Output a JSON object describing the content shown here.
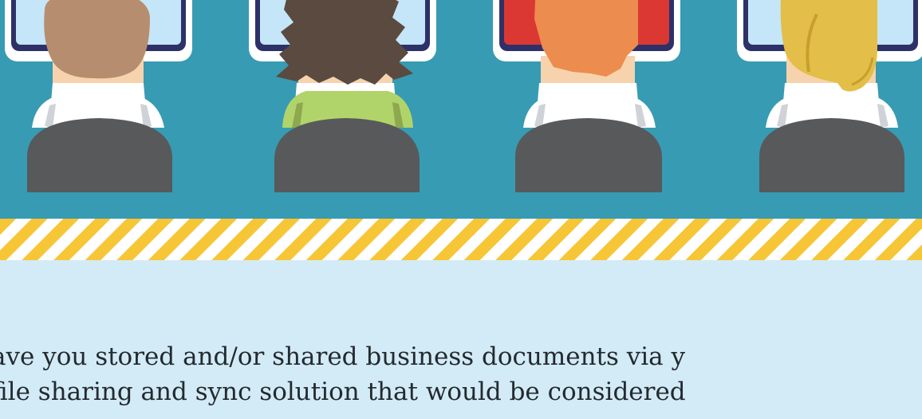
{
  "scene": {
    "colors": {
      "background": "#379bb3",
      "monitor_frame": "#ffffff",
      "monitor_border": "#2e3168",
      "monitor_screen": "#c4e6f8",
      "monitor_screen_red": "#db3834",
      "chair": "#58595b",
      "shirt": "#ffffff",
      "neck": "#f6d3ad",
      "hair_brown": "#b78d6f",
      "hair_dark": "#5a4a40",
      "hair_orange": "#ec8c4e",
      "hair_blonde": "#e3be48",
      "shirt_green": "#b1d46a"
    },
    "people": [
      {
        "icon": "person-brown-hair-icon",
        "hair": "short-brown",
        "screen": "blue"
      },
      {
        "icon": "person-dark-curly-hair-icon",
        "hair": "dark-curly",
        "screen": "blue"
      },
      {
        "icon": "person-orange-hair-icon",
        "hair": "orange",
        "screen": "red"
      },
      {
        "icon": "person-blonde-hair-icon",
        "hair": "blonde",
        "screen": "blue"
      }
    ]
  },
  "divider": {
    "icon": "caution-stripes-divider",
    "colors": [
      "#f7c637",
      "#ffffff"
    ]
  },
  "question": {
    "line1": "ave you stored and/or shared business documents via y",
    "line2": "file sharing and sync solution that would be considered"
  }
}
